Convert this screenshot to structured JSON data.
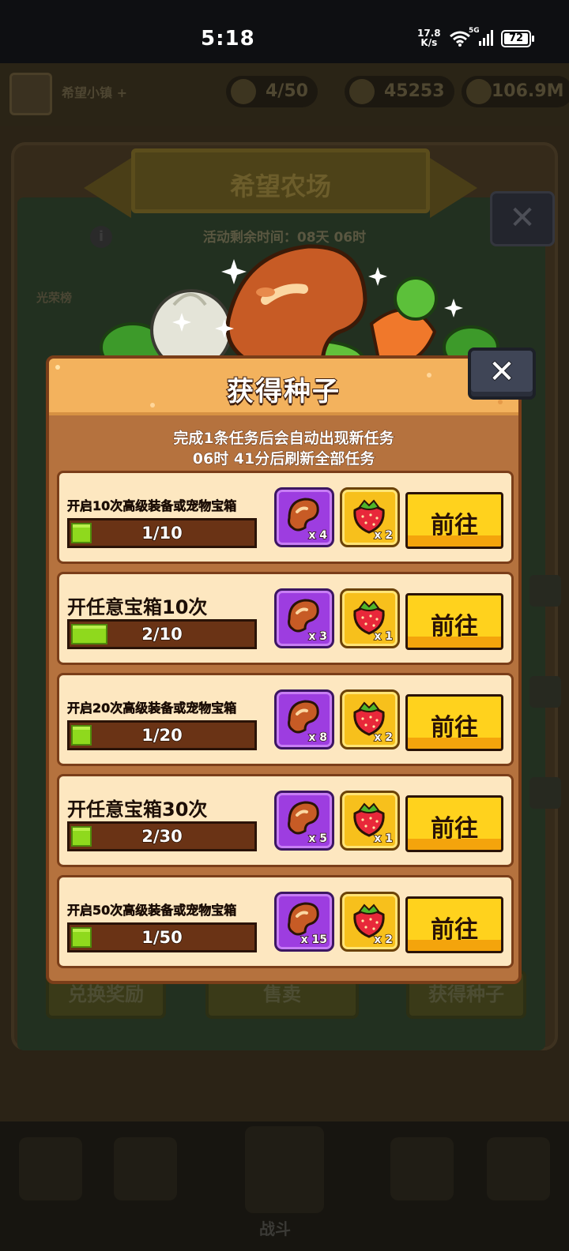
{
  "status": {
    "time": "5:18",
    "net_speed": "17.8",
    "net_unit": "K/s",
    "network": "5G",
    "battery": "72"
  },
  "background": {
    "player_name": "希望小镇 +",
    "stamina": "4/50",
    "gems": "45253",
    "coins": "106.9M",
    "banner_title": "希望农场",
    "countdown": "活动剩余时间：08天 06时",
    "rank_label": "光荣榜",
    "btn_exchange": "兑换奖励",
    "btn_sell": "售卖",
    "btn_seeds": "获得种子",
    "nav_label": "战斗"
  },
  "dialog": {
    "title": "获得种子",
    "close_icon": "close-icon",
    "subtitle_1": "完成1条任务后会自动出现新任务",
    "subtitle_2": "06时 41分后刷新全部任务",
    "colors": {
      "accent": "#ffd21d",
      "progress": "#8fd91d",
      "bean_bg": "#9d3de0",
      "berry_bg": "#f7c01c"
    }
  },
  "tasks": [
    {
      "title": "开启10次高级装备或宠物宝箱",
      "progress_text": "1/10",
      "progress": 0.1,
      "bean_count": "x 4",
      "berry_count": "x 2",
      "button": "前往"
    },
    {
      "title": "开任意宝箱10次",
      "progress_text": "2/10",
      "progress": 0.2,
      "bean_count": "x 3",
      "berry_count": "x 1",
      "button": "前往"
    },
    {
      "title": "开启20次高级装备或宠物宝箱",
      "progress_text": "1/20",
      "progress": 0.05,
      "bean_count": "x 8",
      "berry_count": "x 2",
      "button": "前往"
    },
    {
      "title": "开任意宝箱30次",
      "progress_text": "2/30",
      "progress": 0.067,
      "bean_count": "x 5",
      "berry_count": "x 1",
      "button": "前往"
    },
    {
      "title": "开启50次高级装备或宠物宝箱",
      "progress_text": "1/50",
      "progress": 0.02,
      "bean_count": "x 15",
      "berry_count": "x 2",
      "button": "前往"
    }
  ]
}
